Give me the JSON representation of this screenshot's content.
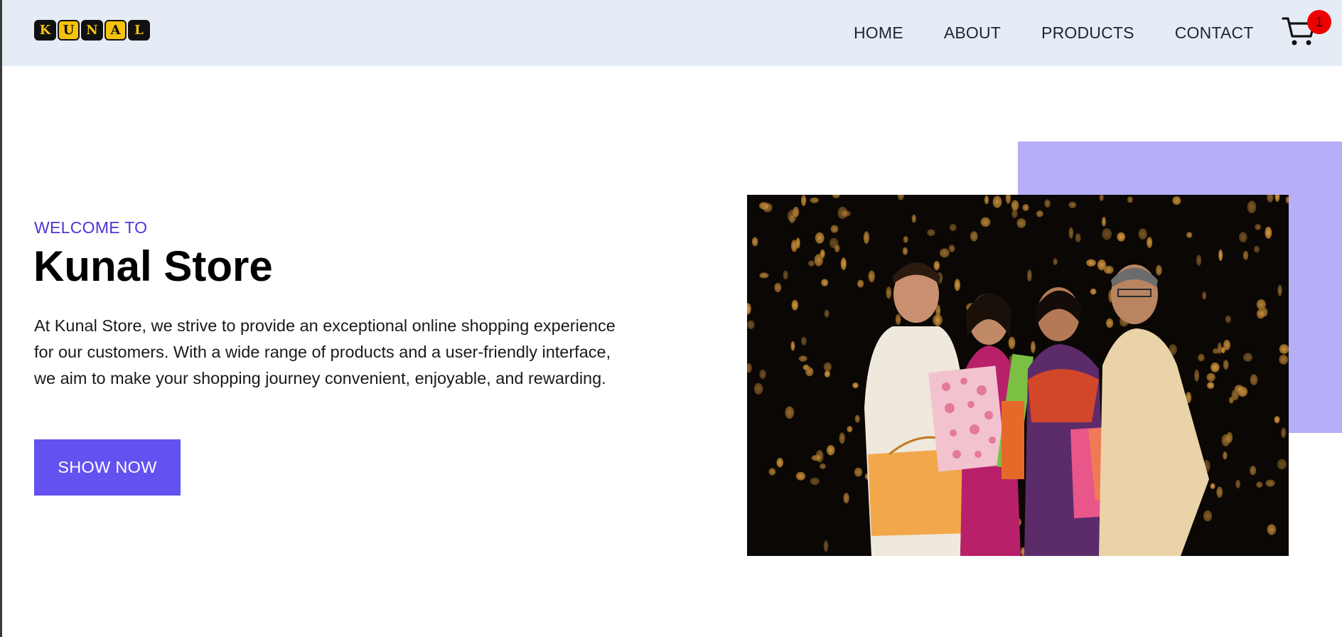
{
  "logo": {
    "letters": [
      "K",
      "U",
      "N",
      "A",
      "L"
    ]
  },
  "nav": {
    "items": [
      {
        "label": "HOME"
      },
      {
        "label": "ABOUT"
      },
      {
        "label": "PRODUCTS"
      },
      {
        "label": "CONTACT"
      }
    ]
  },
  "cart": {
    "icon": "cart-icon",
    "count": "1"
  },
  "hero": {
    "eyebrow": "WELCOME TO",
    "title": "Kunal Store",
    "description": "At Kunal Store, we strive to provide an exceptional online shopping experience for our customers. With a wide range of products and a user-friendly interface, we aim to make your shopping journey convenient, enjoyable, and rewarding.",
    "button_label": "SHOW NOW"
  },
  "colors": {
    "header_bg": "#e5ecf5",
    "accent": "#6351f0",
    "eyebrow": "#4b36d6",
    "accent_box": "#b6aef7",
    "badge": "#ee0000",
    "logo_yellow": "#f5c20c"
  }
}
